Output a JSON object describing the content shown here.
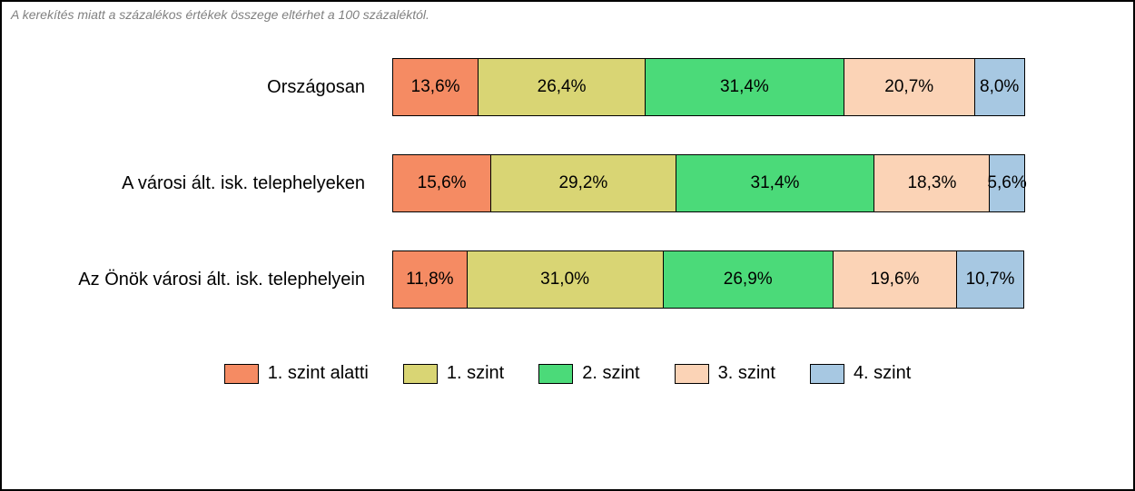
{
  "note": "A kerekítés miatt a százalékos értékek összege eltérhet a 100 százaléktól.",
  "chart_data": {
    "type": "bar",
    "orientation": "horizontal-stacked-100",
    "categories": [
      "Országosan",
      "A városi ált. isk. telephelyeken",
      "Az Önök városi ált. isk. telephelyein"
    ],
    "series": [
      {
        "name": "1. szint alatti",
        "values": [
          13.6,
          15.6,
          11.8
        ],
        "color": "#f58b63"
      },
      {
        "name": "1. szint",
        "values": [
          26.4,
          29.2,
          31.0
        ],
        "color": "#d9d574"
      },
      {
        "name": "2. szint",
        "values": [
          31.4,
          31.4,
          26.9
        ],
        "color": "#4bda79"
      },
      {
        "name": "3. szint",
        "values": [
          20.7,
          18.3,
          19.6
        ],
        "color": "#fbd3b6"
      },
      {
        "name": "4. szint",
        "values": [
          8.0,
          5.6,
          10.7
        ],
        "color": "#a7c8e2"
      }
    ],
    "labels": [
      [
        "13,6%",
        "26,4%",
        "31,4%",
        "20,7%",
        "8,0%"
      ],
      [
        "15,6%",
        "29,2%",
        "31,4%",
        "18,3%",
        "5,6%"
      ],
      [
        "11,8%",
        "31,0%",
        "26,9%",
        "19,6%",
        "10,7%"
      ]
    ],
    "xlim": [
      0,
      100
    ]
  }
}
